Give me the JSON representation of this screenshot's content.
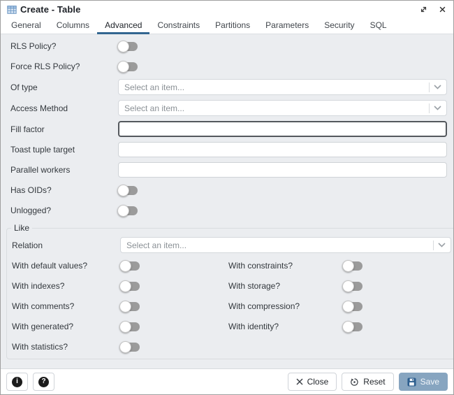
{
  "window": {
    "title": "Create - Table"
  },
  "tabs": {
    "items": [
      "General",
      "Columns",
      "Advanced",
      "Constraints",
      "Partitions",
      "Parameters",
      "Security",
      "SQL"
    ],
    "active": "Advanced"
  },
  "form": {
    "rows": [
      {
        "label": "RLS Policy?",
        "control": "toggle",
        "state": "off"
      },
      {
        "label": "Force RLS Policy?",
        "control": "toggle",
        "state": "off"
      },
      {
        "label": "Of type",
        "control": "select",
        "value": "Select an item..."
      },
      {
        "label": "Access Method",
        "control": "select",
        "value": "Select an item..."
      },
      {
        "label": "Fill factor",
        "control": "text",
        "value": "",
        "focused": true
      },
      {
        "label": "Toast tuple target",
        "control": "text",
        "value": ""
      },
      {
        "label": "Parallel workers",
        "control": "text",
        "value": ""
      },
      {
        "label": "Has OIDs?",
        "control": "toggle",
        "state": "off"
      },
      {
        "label": "Unlogged?",
        "control": "toggle",
        "state": "off"
      }
    ]
  },
  "like": {
    "legend": "Like",
    "relation": {
      "label": "Relation",
      "value": "Select an item..."
    },
    "toggle_rows": [
      {
        "left": "With default values?",
        "right": "With constraints?"
      },
      {
        "left": "With indexes?",
        "right": "With storage?"
      },
      {
        "left": "With comments?",
        "right": "With compression?"
      },
      {
        "left": "With generated?",
        "right": "With identity?"
      },
      {
        "left": "With statistics?",
        "right": ""
      }
    ],
    "toggle_state": "off"
  },
  "footer": {
    "info_glyph": "i",
    "help_glyph": "?",
    "close_label": "Close",
    "reset_label": "Reset",
    "save_label": "Save"
  },
  "colors": {
    "accent": "#326690",
    "content_bg": "#ebedf0",
    "toggle_track": "#9b9b9b",
    "save_disabled_bg": "#87a5c0",
    "save_icon_fill": "#2e5f8f"
  }
}
